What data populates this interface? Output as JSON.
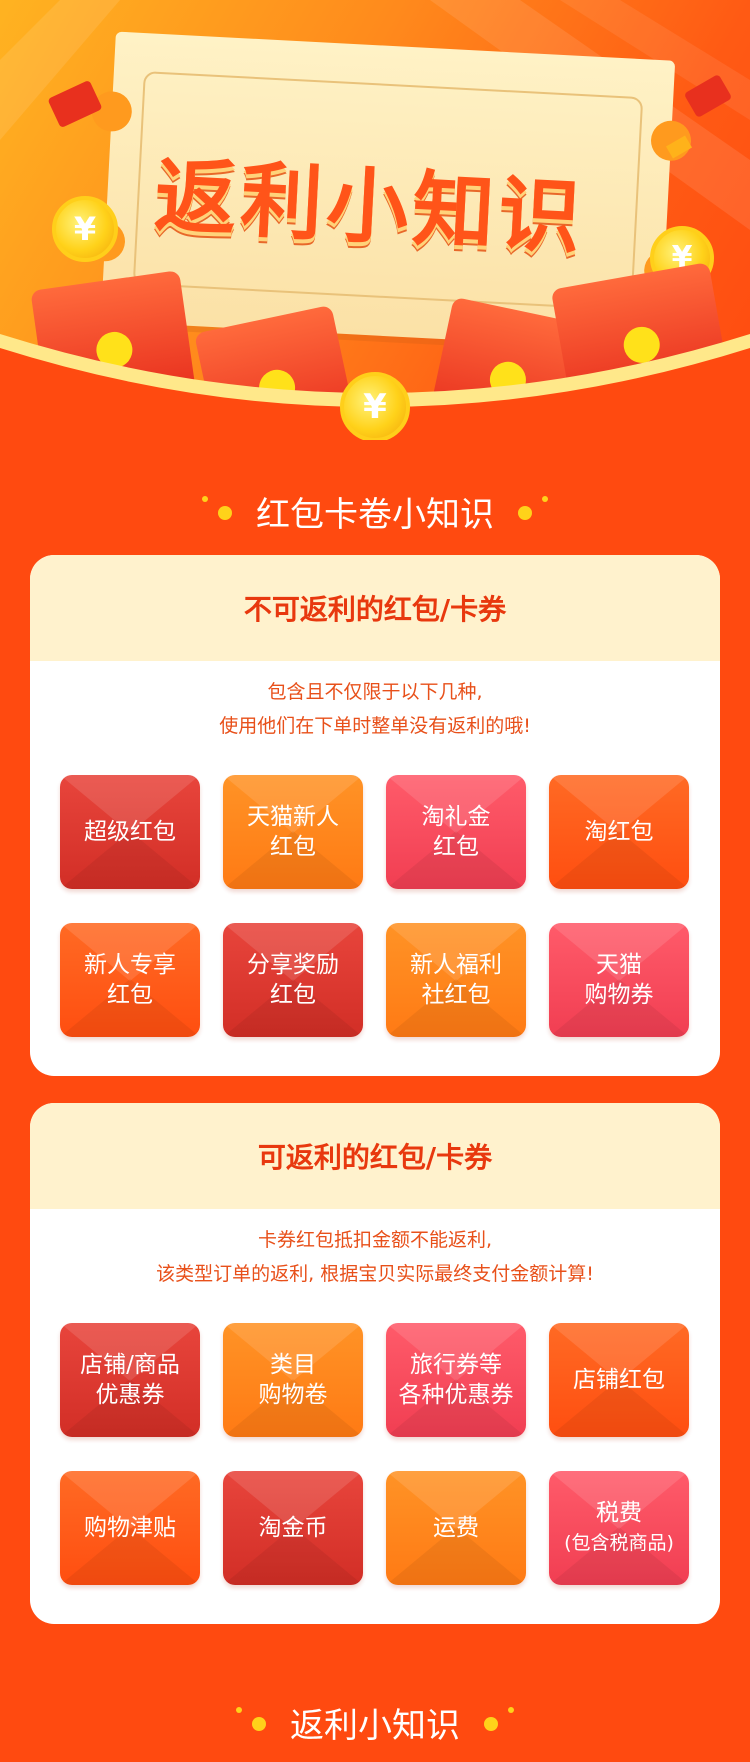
{
  "hero": {
    "title": "返利小知识",
    "coin_symbol": "¥"
  },
  "section1": {
    "heading": "红包卡卷小知识"
  },
  "card_no_rebate": {
    "title": "不可返利的红包/卡券",
    "desc_line1": "包含且不仅限于以下几种,",
    "desc_line2": "使用他们在下单时整单没有返利的哦!",
    "tiles": [
      {
        "label": "超级红包",
        "color": "red"
      },
      {
        "label": "天猫新人\n红包",
        "color": "orange"
      },
      {
        "label": "淘礼金\n红包",
        "color": "pink"
      },
      {
        "label": "淘红包",
        "color": "vermil"
      },
      {
        "label": "新人专享\n红包",
        "color": "vermil"
      },
      {
        "label": "分享奖励\n红包",
        "color": "red"
      },
      {
        "label": "新人福利\n社红包",
        "color": "orange"
      },
      {
        "label": "天猫\n购物券",
        "color": "pink"
      }
    ]
  },
  "card_rebate": {
    "title": "可返利的红包/卡券",
    "desc_line1": "卡券红包抵扣金额不能返利,",
    "desc_line2": "该类型订单的返利, 根据宝贝实际最终支付金额计算!",
    "tiles": [
      {
        "label": "店铺/商品\n优惠券",
        "color": "red"
      },
      {
        "label": "类目\n购物卷",
        "color": "orange"
      },
      {
        "label": "旅行券等\n各种优惠券",
        "color": "pink"
      },
      {
        "label": "店铺红包",
        "color": "vermil"
      },
      {
        "label": "购物津贴",
        "color": "vermil"
      },
      {
        "label": "淘金币",
        "color": "red"
      },
      {
        "label": "运费",
        "color": "orange"
      },
      {
        "label": "税费",
        "sub": "(包含税商品)",
        "color": "pink"
      }
    ]
  },
  "section2": {
    "heading": "返利小知识"
  }
}
